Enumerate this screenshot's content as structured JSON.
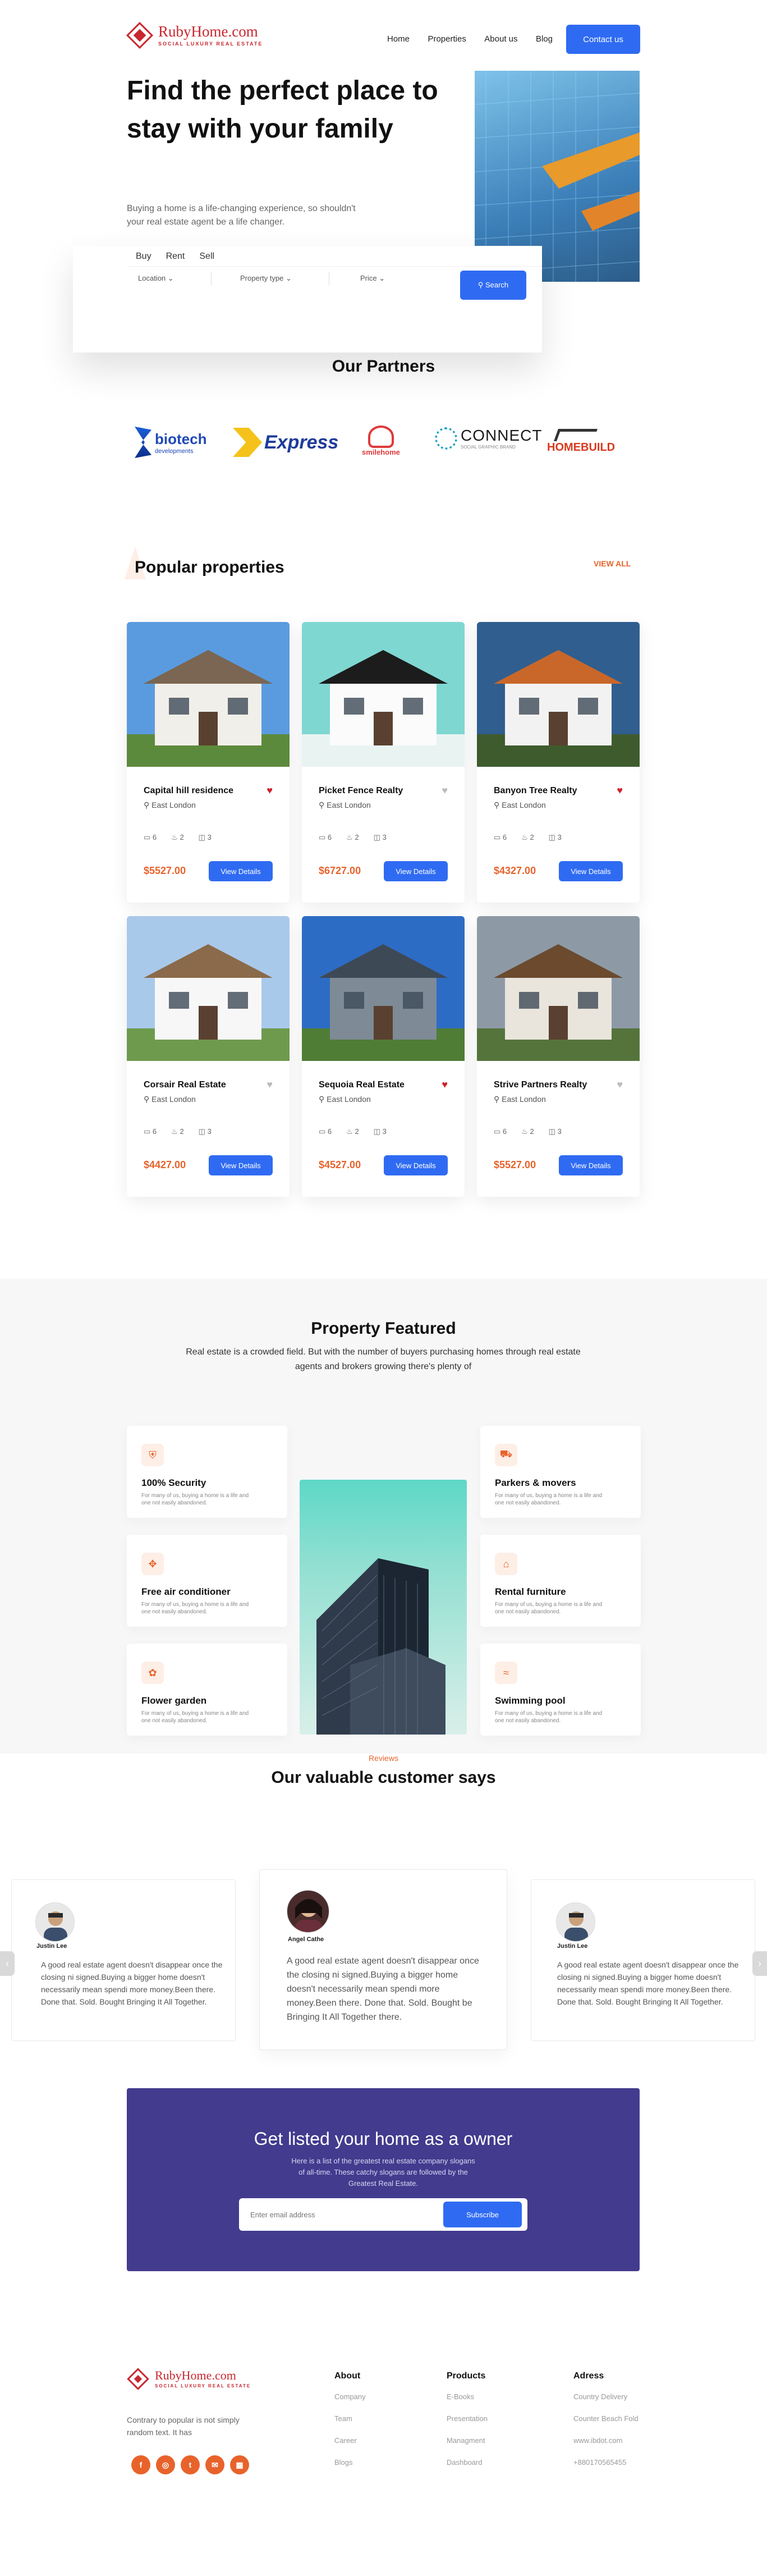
{
  "nav": {
    "logo_name": "RubyHome.com",
    "logo_tagline": "SOCIAL LUXURY REAL ESTATE",
    "links": [
      "Home",
      "Properties",
      "About us",
      "Blog"
    ],
    "contact_label": "Contact us"
  },
  "hero": {
    "title": "Find the perfect place to stay with your family",
    "subtitle": "Buying a home is a life-changing experience, so shouldn't your real estate agent be a life changer.",
    "tabs": [
      "Buy",
      "Rent",
      "Sell"
    ],
    "location_label": "Location",
    "property_type_label": "Property type",
    "price_label": "Price",
    "search_label": "Search"
  },
  "partners": {
    "title": "Our Partners",
    "logos": [
      {
        "name": "biotech",
        "sub": "developments",
        "color": "#1f49b8"
      },
      {
        "name": "Express",
        "sub": "",
        "color": "#1e3c9a"
      },
      {
        "name": "smilehome",
        "sub": "",
        "color": "#e03a3a"
      },
      {
        "name": "CONNECT",
        "sub": "SOCIAL GRAPHIC BRAND",
        "color": "#1a1a1a"
      },
      {
        "name": "HOMEBUILD",
        "sub": "",
        "color": "#d83a1f"
      }
    ]
  },
  "popular": {
    "title": "Popular properties",
    "view_all": "VIEW ALL",
    "location": "East London",
    "details_label": "View Details",
    "cards": [
      {
        "title": "Capital hill residence",
        "price": "$5527.00",
        "beds": "6",
        "baths": "2",
        "area": "3",
        "liked": true,
        "sky": "#5a9be0",
        "wall": "#f1efe9",
        "roof": "#7a6652",
        "ground": "#5c8a3c"
      },
      {
        "title": "Picket Fence Realty",
        "price": "$6727.00",
        "beds": "6",
        "baths": "2",
        "area": "3",
        "liked": false,
        "sky": "#7fd7d2",
        "wall": "#fbfbfb",
        "roof": "#1c1c1c",
        "ground": "#e9f3f2"
      },
      {
        "title": "Banyon Tree Realty",
        "price": "$4327.00",
        "beds": "6",
        "baths": "2",
        "area": "3",
        "liked": true,
        "sky": "#2f5e8f",
        "wall": "#f2f2f2",
        "roof": "#c9672a",
        "ground": "#3e5b2e"
      },
      {
        "title": "Corsair Real Estate",
        "price": "$4427.00",
        "beds": "6",
        "baths": "2",
        "area": "3",
        "liked": false,
        "sky": "#a9c9ea",
        "wall": "#f7f7f7",
        "roof": "#8a6a4a",
        "ground": "#6e9a4e"
      },
      {
        "title": "Sequoia Real Estate",
        "price": "$4527.00",
        "beds": "6",
        "baths": "2",
        "area": "3",
        "liked": true,
        "sky": "#2d6cc4",
        "wall": "#7e8a96",
        "roof": "#3e4956",
        "ground": "#4f7d36"
      },
      {
        "title": "Strive Partners Realty",
        "price": "$5527.00",
        "beds": "6",
        "baths": "2",
        "area": "3",
        "liked": false,
        "sky": "#8d9aa6",
        "wall": "#e9e5dc",
        "roof": "#6b4a2e",
        "ground": "#54743c"
      }
    ]
  },
  "featured": {
    "title": "Property Featured",
    "subtitle": "Real estate is a crowded field. But with the number of buyers purchasing homes through real estate agents and brokers growing there's plenty of",
    "desc": "For many of us, buying a home is a life and one not easily abandoned.",
    "items": [
      {
        "title": "100% Security",
        "icon": "shield-icon",
        "glyph": "⛨"
      },
      {
        "title": "Free air conditioner",
        "icon": "fan-icon",
        "glyph": "✥"
      },
      {
        "title": "Flower garden",
        "icon": "flower-icon",
        "glyph": "✿"
      },
      {
        "title": "Parkers & movers",
        "icon": "car-icon",
        "glyph": "⛟"
      },
      {
        "title": "Rental furniture",
        "icon": "sofa-icon",
        "glyph": "⌂"
      },
      {
        "title": "Swimming pool",
        "icon": "pool-icon",
        "glyph": "≈"
      }
    ]
  },
  "reviews": {
    "eyebrow": "Reviews",
    "title": "Our valuable customer says",
    "text": "A good real estate agent doesn't disappear once the closing ni signed.Buying a bigger home doesn't necessarily mean spendi more money.Been there. Done that. Sold. Bought Bringing It All Together.",
    "text_center": "A good real estate agent doesn't disappear once the closing ni signed.Buying a bigger home doesn't necessarily mean spendi more money.Been there. Done that. Sold. Bought be Bringing It All Together there.",
    "names": [
      "Justin Lee",
      "Angel Cathe",
      "Justin Lee"
    ]
  },
  "listing": {
    "title": "Get listed your home as a owner",
    "subtitle": "Here is a list of the greatest real estate company slogans of all-time. These catchy slogans are followed by the Greatest Real Estate.",
    "placeholder": "Enter email address",
    "subscribe_label": "Subscribe",
    "bg_color": "#433b8e"
  },
  "footer": {
    "blurb": "Contrary to popular is not simply random text. It has",
    "cols": [
      {
        "title": "About",
        "items": [
          "Company",
          "Team",
          "Career",
          "Blogs"
        ]
      },
      {
        "title": "Products",
        "items": [
          "E-Books",
          "Presentation",
          "Managment",
          "Dashboard"
        ]
      },
      {
        "title": "Adress",
        "items": [
          "Country Delivery",
          "Counter Beach Fold",
          "www.ibdot.com",
          "+880170565455"
        ]
      }
    ],
    "socials": [
      "f",
      "◎",
      "t",
      "✉",
      "▦"
    ]
  },
  "colors": {
    "accent": "#2f6bf2",
    "brand": "#c9272f",
    "orange": "#e8632b"
  }
}
